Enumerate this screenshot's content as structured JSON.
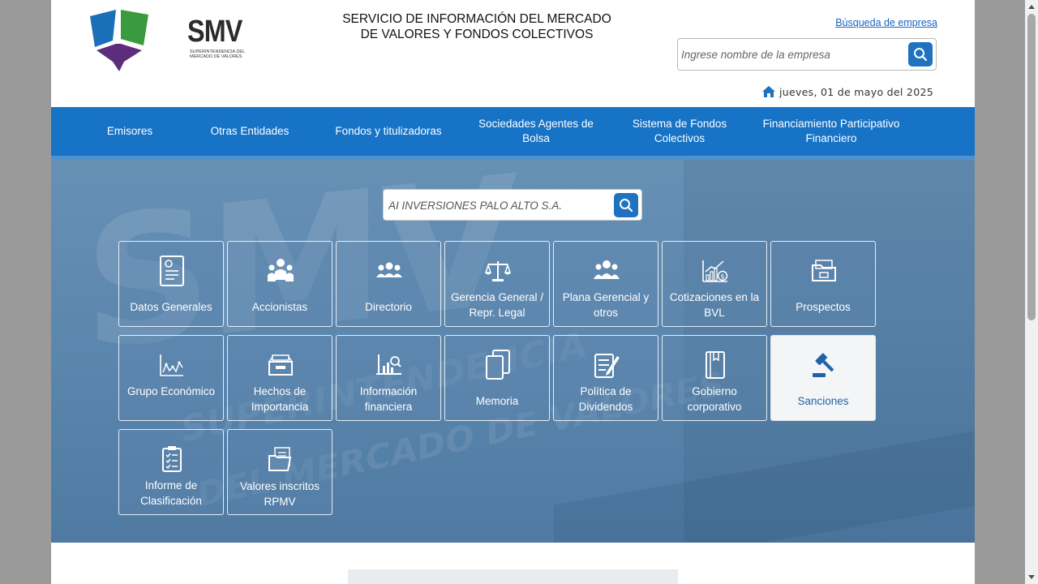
{
  "header": {
    "logo_text": "SMV",
    "logo_sub": "SUPERINTENDENCIA DEL MERCADO DE VALORES",
    "service_title_line1": "SERVICIO DE INFORMACIÓN DEL MERCADO",
    "service_title_line2": "DE VALORES Y FONDOS COLECTIVOS",
    "busqueda_link": "Búsqueda de empresa",
    "search_placeholder": "Ingrese nombre de la empresa",
    "date": "jueves, 01 de mayo del 2025"
  },
  "nav": {
    "items": [
      "Emisores",
      "Otras Entidades",
      "Fondos y titulizadoras",
      "Sociedades Agentes de Bolsa",
      "Sistema de Fondos Colectivos",
      "Financiamiento Participativo Financiero"
    ]
  },
  "hero": {
    "company_value": "AI INVERSIONES PALO ALTO S.A.",
    "watermark": "SMV",
    "watermark_sub1": "SUPERINTENDENCIA",
    "watermark_sub2": "DEL MERCADO DE VALORES",
    "tiles": [
      {
        "label": "Datos Generales",
        "icon": "certificate-icon"
      },
      {
        "label": "Accionistas",
        "icon": "shareholders-icon"
      },
      {
        "label": "Directorio",
        "icon": "group-icon"
      },
      {
        "label": "Gerencia General / Repr. Legal",
        "icon": "scale-icon"
      },
      {
        "label": "Plana Gerencial y otros",
        "icon": "team-icon"
      },
      {
        "label": "Cotizaciones en la BVL",
        "icon": "chart-coin-icon"
      },
      {
        "label": "Prospectos",
        "icon": "folder-icon"
      },
      {
        "label": "Grupo Económico",
        "icon": "line-chart-icon"
      },
      {
        "label": "Hechos de Importancia",
        "icon": "inbox-icon"
      },
      {
        "label": "Información financiera",
        "icon": "financial-chart-icon"
      },
      {
        "label": "Memoria",
        "icon": "documents-icon"
      },
      {
        "label": "Política de Dividendos",
        "icon": "edit-document-icon"
      },
      {
        "label": "Gobierno corporativo",
        "icon": "book-icon"
      },
      {
        "label": "Sanciones",
        "icon": "gavel-icon"
      },
      {
        "label": "Informe de Clasificación",
        "icon": "checklist-icon"
      },
      {
        "label": "Valores inscritos RPMV",
        "icon": "files-icon"
      }
    ]
  },
  "colors": {
    "nav_blue": "#1673c6",
    "button_blue": "#1e72c0",
    "link_blue": "#1565c0",
    "active_tile_text": "#1e63a8"
  }
}
